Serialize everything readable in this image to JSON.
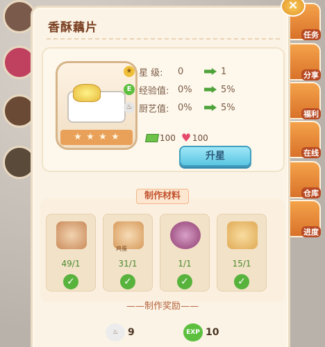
{
  "title": "香酥藕片",
  "close_label": "×",
  "stats": [
    {
      "label": "星  级:",
      "current": "0",
      "next": "1"
    },
    {
      "label": "经验值:",
      "current": "0%",
      "next": "5%"
    },
    {
      "label": "厨艺值:",
      "current": "0%",
      "next": "5%"
    }
  ],
  "cost": {
    "money": "100",
    "hearts": "100"
  },
  "upgrade_button": "升星",
  "materials_heading": "制作材料",
  "materials": [
    {
      "name": "lotus-root",
      "count": "49/1",
      "tag": ""
    },
    {
      "name": "eggs",
      "count": "31/1",
      "tag": "鸡蛋"
    },
    {
      "name": "onion",
      "count": "1/1",
      "tag": ""
    },
    {
      "name": "ginger",
      "count": "15/1",
      "tag": ""
    }
  ],
  "rewards_heading": "——制作奖励——",
  "rewards": [
    {
      "icon": "chef-skill-icon",
      "value": "9"
    },
    {
      "icon": "exp-icon",
      "value": "10"
    }
  ],
  "right_sidebar": [
    "任务",
    "分享",
    "福利",
    "在线",
    "仓库",
    "进度"
  ],
  "colors": {
    "panel_bg": "#fbf4e6",
    "title_text": "#7a3f22",
    "green_value": "#4a8a2e",
    "button_blue": "#5bc6e2"
  }
}
